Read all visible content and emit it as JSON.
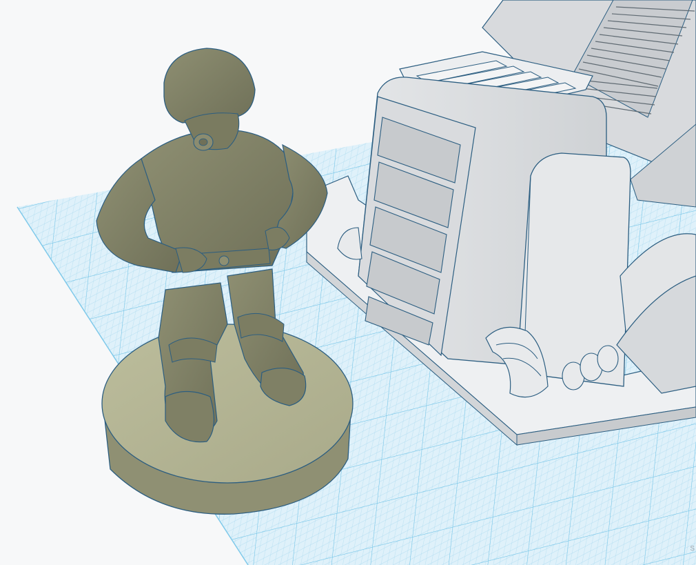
{
  "viewport": {
    "colors": {
      "background": "#f7f8f9",
      "grid_fill": "#dff1fa",
      "grid_minor": "#a9d9ef",
      "grid_major": "#6cc1e6",
      "edge_outline": "#2b5d80",
      "figure_color": "#85866a",
      "figure_dark": "#6f7058",
      "base_color": "#b6b796",
      "structure_color": "#dcdee0",
      "structure_light": "#eceef0"
    },
    "objects": {
      "figure_name": "soldier-figure",
      "structure_name": "sci-fi-structure"
    }
  },
  "status": {
    "snap_text": "S"
  }
}
